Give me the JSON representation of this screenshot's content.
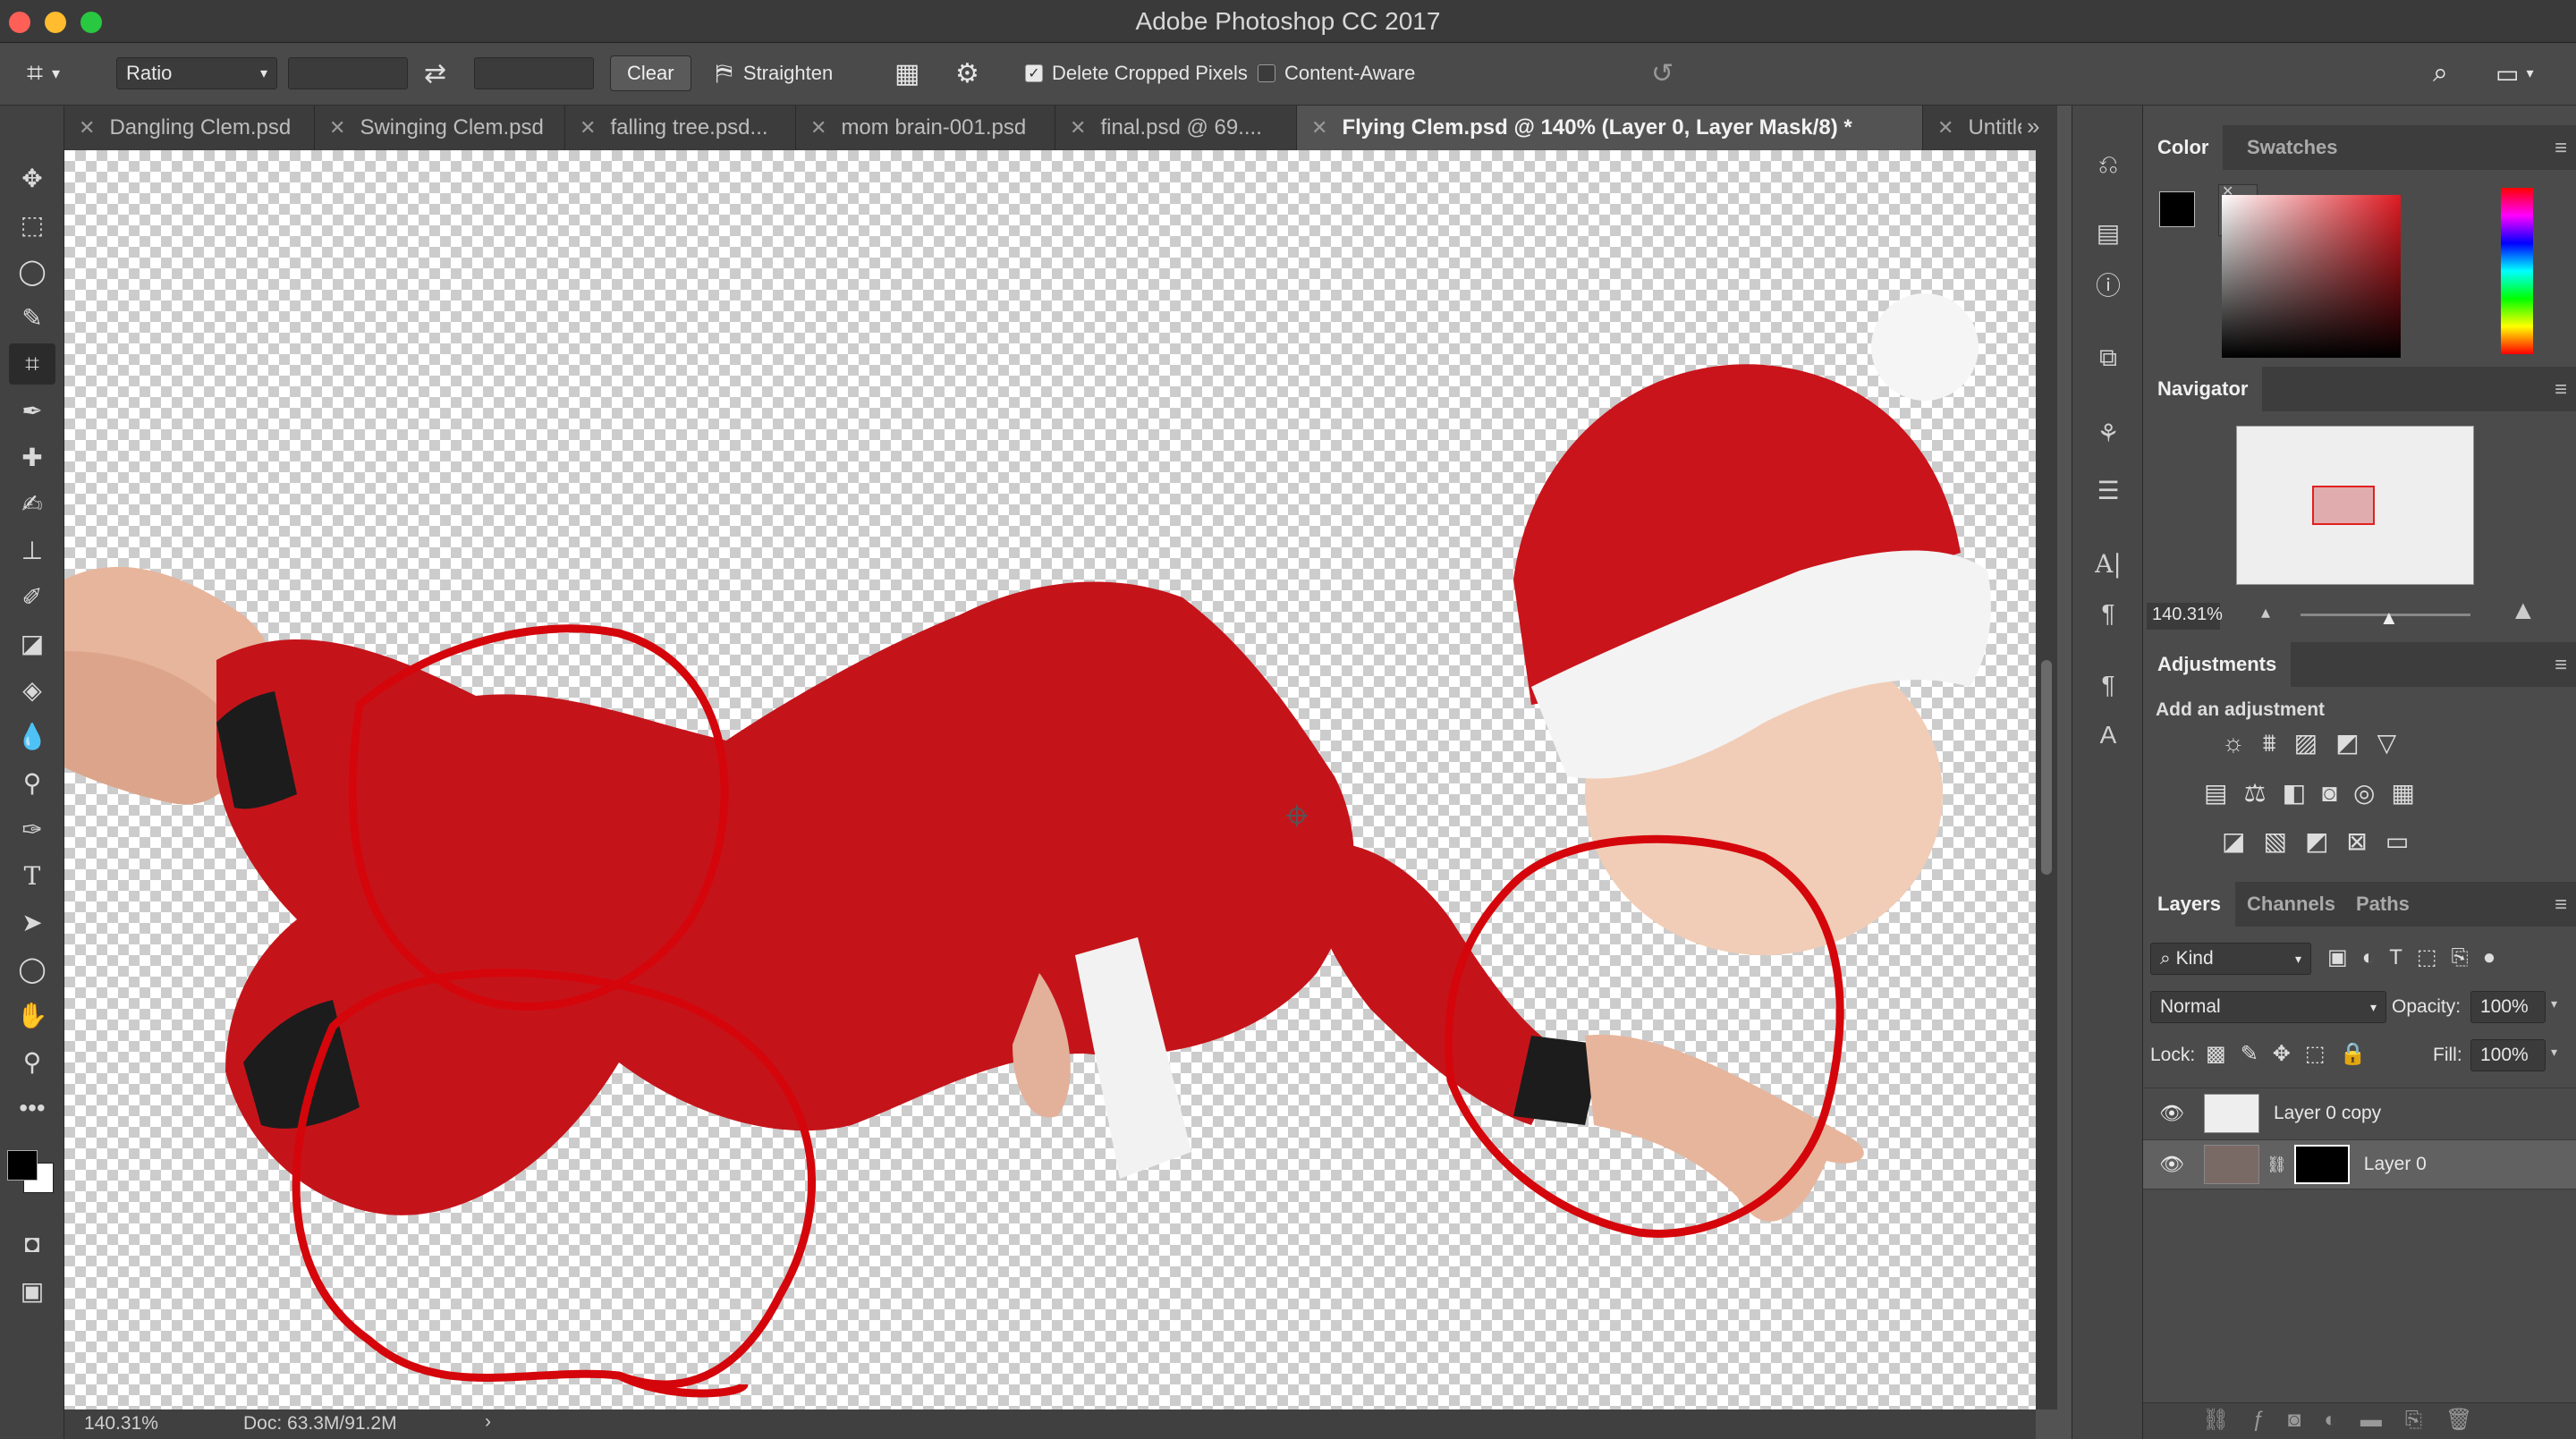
{
  "window": {
    "title": "Adobe Photoshop CC 2017"
  },
  "options_bar": {
    "ratio_label": "Ratio",
    "clear_label": "Clear",
    "straighten_label": "Straighten",
    "delete_cropped_label": "Delete Cropped Pixels",
    "delete_cropped_checked": true,
    "content_aware_label": "Content-Aware",
    "content_aware_checked": false
  },
  "tabs": [
    {
      "label": "Dangling Clem.psd"
    },
    {
      "label": "Swinging Clem.psd"
    },
    {
      "label": "falling tree.psd..."
    },
    {
      "label": "mom brain-001.psd"
    },
    {
      "label": "final.psd @ 69...."
    },
    {
      "label": "Flying Clem.psd @ 140% (Layer 0, Layer Mask/8) *",
      "active": true
    },
    {
      "label": "Untitled-"
    }
  ],
  "status": {
    "zoom": "140.31%",
    "doc": "Doc: 63.3M/91.2M"
  },
  "color_panel": {
    "tabs": [
      "Color",
      "Swatches"
    ]
  },
  "navigator": {
    "title": "Navigator",
    "zoom": "140.31%"
  },
  "adjustments": {
    "title": "Adjustments",
    "subtitle": "Add an adjustment"
  },
  "layers_panel": {
    "tabs": [
      "Layers",
      "Channels",
      "Paths"
    ],
    "filter": "Kind",
    "blend_mode": "Normal",
    "opacity_label": "Opacity:",
    "opacity_value": "100%",
    "lock_label": "Lock:",
    "fill_label": "Fill:",
    "fill_value": "100%",
    "layers": [
      {
        "name": "Layer 0 copy"
      },
      {
        "name": "Layer 0",
        "selected": true
      }
    ]
  }
}
